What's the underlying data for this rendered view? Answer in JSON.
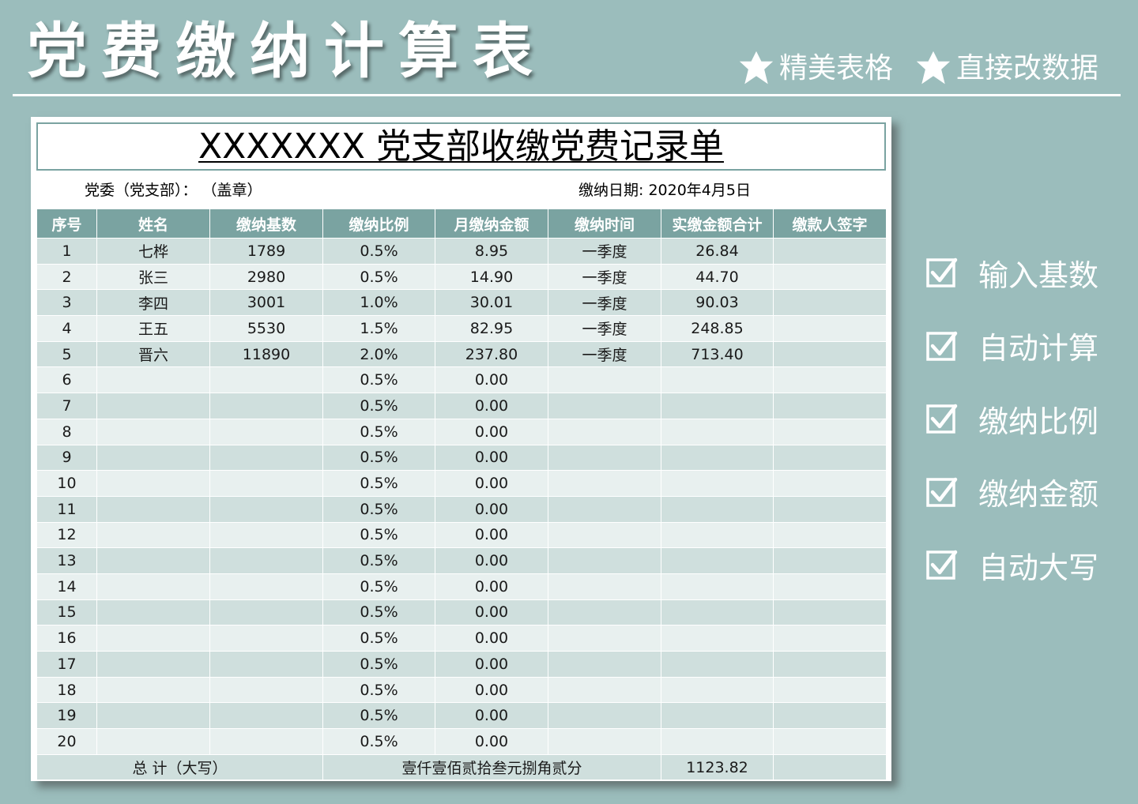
{
  "header": {
    "title": "党费缴纳计算表",
    "features": [
      "精美表格",
      "直接改数据"
    ]
  },
  "form": {
    "title": "XXXXXXX  党支部收缴党费记录单",
    "committee_label": "党委（党支部）：  （盖章）",
    "date_label": "缴纳日期:   2020年4月5日"
  },
  "table": {
    "columns": [
      "序号",
      "姓名",
      "缴纳基数",
      "缴纳比例",
      "月缴纳金额",
      "缴纳时间",
      "实缴金额合计",
      "缴款人签字"
    ],
    "rows": [
      [
        "1",
        "七桦",
        "1789",
        "0.5%",
        "8.95",
        "一季度",
        "26.84",
        ""
      ],
      [
        "2",
        "张三",
        "2980",
        "0.5%",
        "14.90",
        "一季度",
        "44.70",
        ""
      ],
      [
        "3",
        "李四",
        "3001",
        "1.0%",
        "30.01",
        "一季度",
        "90.03",
        ""
      ],
      [
        "4",
        "王五",
        "5530",
        "1.5%",
        "82.95",
        "一季度",
        "248.85",
        ""
      ],
      [
        "5",
        "晋六",
        "11890",
        "2.0%",
        "237.80",
        "一季度",
        "713.40",
        ""
      ],
      [
        "6",
        "",
        "",
        "0.5%",
        "0.00",
        "",
        "",
        ""
      ],
      [
        "7",
        "",
        "",
        "0.5%",
        "0.00",
        "",
        "",
        ""
      ],
      [
        "8",
        "",
        "",
        "0.5%",
        "0.00",
        "",
        "",
        ""
      ],
      [
        "9",
        "",
        "",
        "0.5%",
        "0.00",
        "",
        "",
        ""
      ],
      [
        "10",
        "",
        "",
        "0.5%",
        "0.00",
        "",
        "",
        ""
      ],
      [
        "11",
        "",
        "",
        "0.5%",
        "0.00",
        "",
        "",
        ""
      ],
      [
        "12",
        "",
        "",
        "0.5%",
        "0.00",
        "",
        "",
        ""
      ],
      [
        "13",
        "",
        "",
        "0.5%",
        "0.00",
        "",
        "",
        ""
      ],
      [
        "14",
        "",
        "",
        "0.5%",
        "0.00",
        "",
        "",
        ""
      ],
      [
        "15",
        "",
        "",
        "0.5%",
        "0.00",
        "",
        "",
        ""
      ],
      [
        "16",
        "",
        "",
        "0.5%",
        "0.00",
        "",
        "",
        ""
      ],
      [
        "17",
        "",
        "",
        "0.5%",
        "0.00",
        "",
        "",
        ""
      ],
      [
        "18",
        "",
        "",
        "0.5%",
        "0.00",
        "",
        "",
        ""
      ],
      [
        "19",
        "",
        "",
        "0.5%",
        "0.00",
        "",
        "",
        ""
      ],
      [
        "20",
        "",
        "",
        "0.5%",
        "0.00",
        "",
        "",
        ""
      ]
    ],
    "total": {
      "label": "总  计（大写）",
      "amount_in_words": "壹仟壹佰贰拾叁元捌角贰分",
      "amount": "1123.82"
    }
  },
  "checklist": [
    "输入基数",
    "自动计算",
    "缴纳比例",
    "缴纳金额",
    "自动大写"
  ],
  "icons": {
    "feature": "star-icon",
    "check": "checkbox-checked-icon"
  },
  "colors": {
    "background": "#9bbdbc",
    "header_fill": "#7aa3a1",
    "row_dark": "#cfdfdd",
    "row_light": "#e8f0ef"
  }
}
